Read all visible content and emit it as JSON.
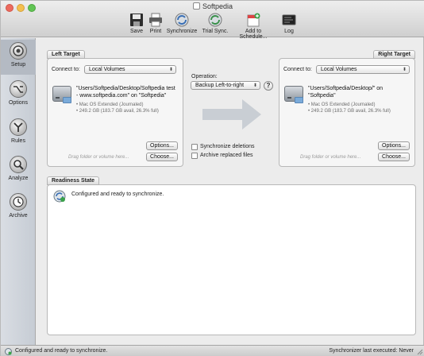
{
  "window": {
    "title": "Softpedia"
  },
  "toolbar": [
    {
      "label": "Save",
      "icon": "floppy-disk-icon"
    },
    {
      "label": "Print",
      "icon": "printer-icon"
    },
    {
      "label": "Synchronize",
      "icon": "sync-icon"
    },
    {
      "label": "Trial Sync.",
      "icon": "sync-trial-icon"
    },
    {
      "label": "Add to Schedule...",
      "icon": "calendar-add-icon"
    },
    {
      "label": "Log",
      "icon": "log-icon"
    }
  ],
  "sidebar": [
    {
      "label": "Setup",
      "icon": "target-icon",
      "active": true
    },
    {
      "label": "Options",
      "icon": "option-key-icon",
      "active": false
    },
    {
      "label": "Rules",
      "icon": "branch-icon",
      "active": false
    },
    {
      "label": "Analyze",
      "icon": "magnifier-icon",
      "active": false
    },
    {
      "label": "Archive",
      "icon": "clock-icon",
      "active": false
    }
  ],
  "left_target": {
    "title": "Left Target",
    "connect_label": "Connect to:",
    "connect_value": "Local Volumes",
    "name_lines": [
      "\"Users/Softpedia/Desktop/Softpedia test",
      "- www.softpedia.com\" on \"Softpedia\""
    ],
    "info": [
      "• Mac OS Extended (Journaled)",
      "• 249.2 GB (183.7 GB avail, 26.3% full)"
    ],
    "drag_hint": "Drag folder or volume here...",
    "options_label": "Options...",
    "choose_label": "Choose..."
  },
  "right_target": {
    "title": "Right Target",
    "connect_label": "Connect to:",
    "connect_value": "Local Volumes",
    "name_lines": [
      "\"Users/Softpedia/Desktop/\" on",
      "\"Softpedia\""
    ],
    "info": [
      "• Mac OS Extended (Journaled)",
      "• 249.2 GB (183.7 GB avail, 26.3% full)"
    ],
    "drag_hint": "Drag folder or volume here...",
    "options_label": "Options...",
    "choose_label": "Choose..."
  },
  "operation": {
    "label": "Operation:",
    "value": "Backup Left-to-right",
    "help": "?",
    "sync_deletions": "Synchronize deletions",
    "archive_replaced": "Archive replaced files"
  },
  "readiness": {
    "title": "Readiness State",
    "message": "Configured and ready to synchronize."
  },
  "status_bar": {
    "left": "Configured and ready to synchronize.",
    "right": "Synchronizer last executed:  Never"
  }
}
